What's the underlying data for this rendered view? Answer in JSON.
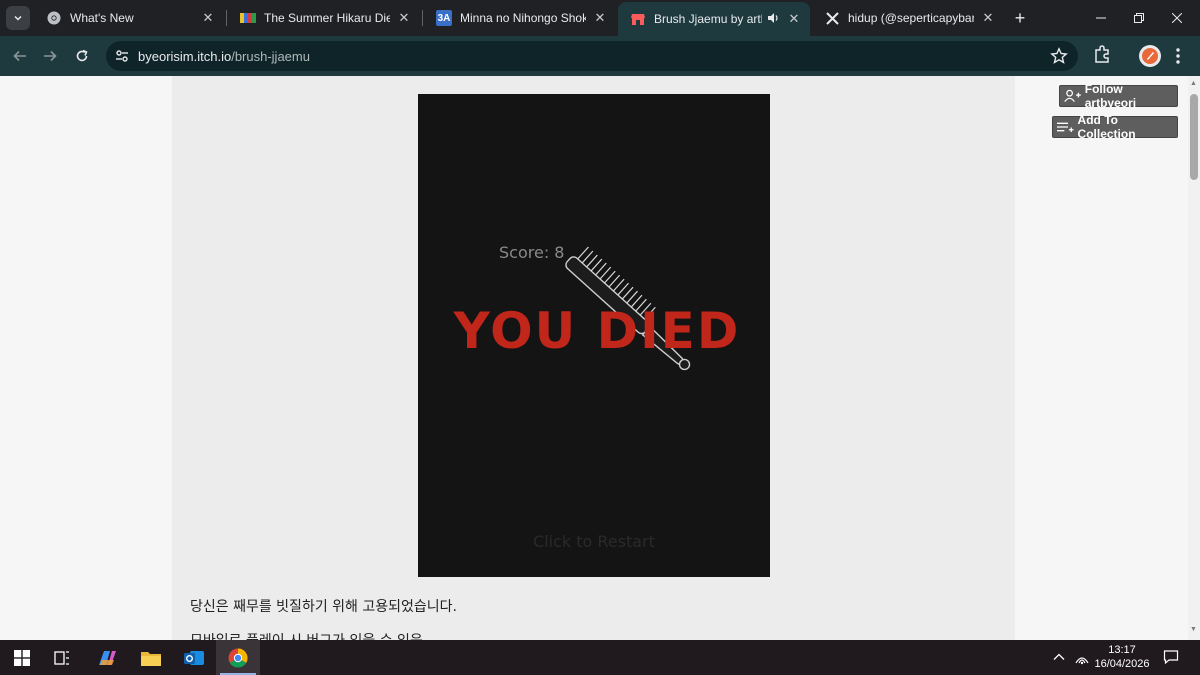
{
  "tabs": [
    {
      "title": "What's New",
      "icon": "chrome-icon"
    },
    {
      "title": "The Summer Hikaru Died No",
      "icon": "site-favicon"
    },
    {
      "title": "Minna no Nihongo Shokyu I",
      "icon": "3a-favicon",
      "icon_text": "3A"
    },
    {
      "title": "Brush Jjaemu by artbyeor",
      "icon": "itch-icon",
      "active": true,
      "audio": true
    },
    {
      "title": "hidup (@seperticapybara) /",
      "icon": "x-icon"
    }
  ],
  "address": {
    "host": "byeorisim.itch.io",
    "path": "/brush-jjaemu"
  },
  "page": {
    "follow_label": "Follow artbyeori",
    "collection_label": "Add To Collection",
    "game": {
      "score_text": "Score: 8",
      "died_text": "YOU DIED",
      "restart_text": "Click to Restart"
    },
    "description": [
      "당신은 째무를 빗질하기 위해 고용되었습니다.",
      "모바일로 플레이 시 버그가 있을 수 있음."
    ]
  },
  "taskbar": {
    "time": "13:17",
    "date": "16/04/2026"
  },
  "colors": {
    "tab_active": "#1f3a3f",
    "died_red": "#c0261a",
    "game_bg": "#141414"
  }
}
